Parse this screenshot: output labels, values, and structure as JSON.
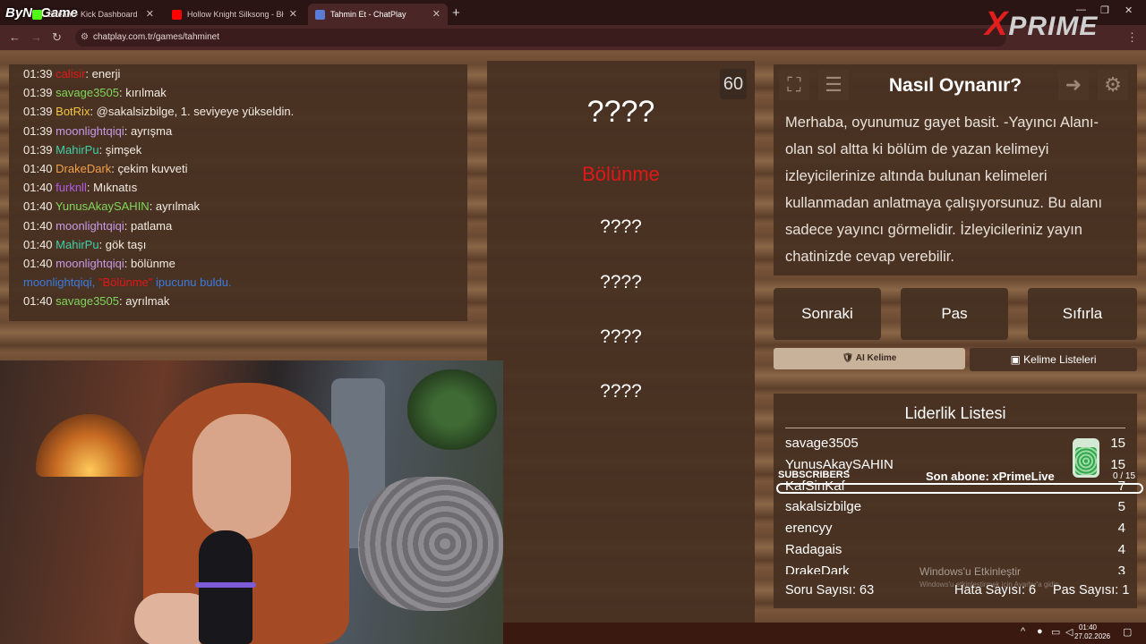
{
  "browser": {
    "tabs": [
      {
        "label": "Stream - Kick Dashboard",
        "color": "#53fc18"
      },
      {
        "label": "Hollow Knight Silksong - Bł",
        "color": "#ff0000"
      },
      {
        "label": "Tahmin Et - ChatPlay",
        "color": "#5a7bd6"
      }
    ],
    "url": "chatplay.com.tr/games/tahminet",
    "overlay_logo_left": "ByNoGame",
    "overlay_logo_right_x": "X",
    "overlay_logo_right_rest": "PRIME"
  },
  "chat": {
    "lines": [
      {
        "time": "01:39",
        "user": "calisir",
        "user_color": "#e01818",
        "text": "enerji"
      },
      {
        "time": "01:39",
        "user": "savage3505",
        "user_color": "#7fd65a",
        "text": "kırılmak"
      },
      {
        "time": "01:39",
        "user": "BotRix",
        "user_color": "#f2c542",
        "text": "@sakalsizbilge, 1. seviyeye yükseldin."
      },
      {
        "time": "01:39",
        "user": "moonlightqiqi",
        "user_color": "#c79ae8",
        "text": "ayrışma"
      },
      {
        "time": "01:39",
        "user": "MahirPu",
        "user_color": "#3ecfa8",
        "text": "şimşek"
      },
      {
        "time": "01:40",
        "user": "DrakeDark",
        "user_color": "#f2a04a",
        "text": "çekim kuvveti"
      },
      {
        "time": "01:40",
        "user": "furknll",
        "user_color": "#b05ee8",
        "text": "Mıknatıs"
      },
      {
        "time": "01:40",
        "user": "YunusAkaySAHIN",
        "user_color": "#7fd65a",
        "text": "ayrılmak"
      },
      {
        "time": "01:40",
        "user": "moonlightqiqi",
        "user_color": "#c79ae8",
        "text": "patlama"
      },
      {
        "time": "01:40",
        "user": "MahirPu",
        "user_color": "#3ecfa8",
        "text": "gök taşı"
      },
      {
        "time": "01:40",
        "user": "moonlightqiqi",
        "user_color": "#c79ae8",
        "text": "bölünme"
      }
    ],
    "system": {
      "user": "moonlightqiqi,",
      "word": "\"Bölünme\"",
      "text": "ipucunu buldu."
    },
    "last": {
      "time": "01:40",
      "user": "savage3505",
      "user_color": "#7fd65a",
      "text": "ayrılmak"
    }
  },
  "game": {
    "timer": "60",
    "top_word": "????",
    "revealed_word": "Bölünme",
    "hidden_words": [
      "????",
      "????",
      "????",
      "????"
    ]
  },
  "how_to": {
    "title": "Nasıl Oynanır?",
    "text": "Merhaba, oyunumuz gayet basit. -Yayıncı Alanı- olan sol altta ki bölüm de yazan kelimeyi izleyicilerinize altında bulunan kelimeleri kullanmadan anlatmaya çalışıyorsunuz. Bu alanı sadece yayıncı görmelidir. İzleyicileriniz yayın chatinizde cevap verebilir."
  },
  "controls": {
    "next": "Sonraki",
    "pass": "Pas",
    "reset": "Sıfırla",
    "ai_word": "🛡 AI Kelime",
    "word_lists": "Kelime Listeleri"
  },
  "leaderboard": {
    "title": "Liderlik Listesi",
    "rows": [
      {
        "name": "savage3505",
        "score": "15"
      },
      {
        "name": "YunusAkaySAHIN",
        "score": "15"
      },
      {
        "name": "KafSinKaf",
        "score": "7"
      },
      {
        "name": "sakalsizbilge",
        "score": "5"
      },
      {
        "name": "erencyy",
        "score": "4"
      },
      {
        "name": "Radagais",
        "score": "4"
      },
      {
        "name": "DrakeDark",
        "score": "3"
      }
    ],
    "questions": "Soru Sayısı: 63",
    "errors": "Hata Sayısı: 6",
    "passes": "Pas Sayısı: 1"
  },
  "subs_overlay": {
    "label": "SUBSCRIBERS",
    "last": "Son abone: xPrimeLive",
    "count": "0 / 15",
    "progress": 0
  },
  "windows": {
    "activate_title": "Windows'u Etkinleştir",
    "activate_sub": "Windows'u etkinleştirmek için Ayarlar'a gidin.",
    "time": "01:40",
    "date": "27.02.2026"
  }
}
